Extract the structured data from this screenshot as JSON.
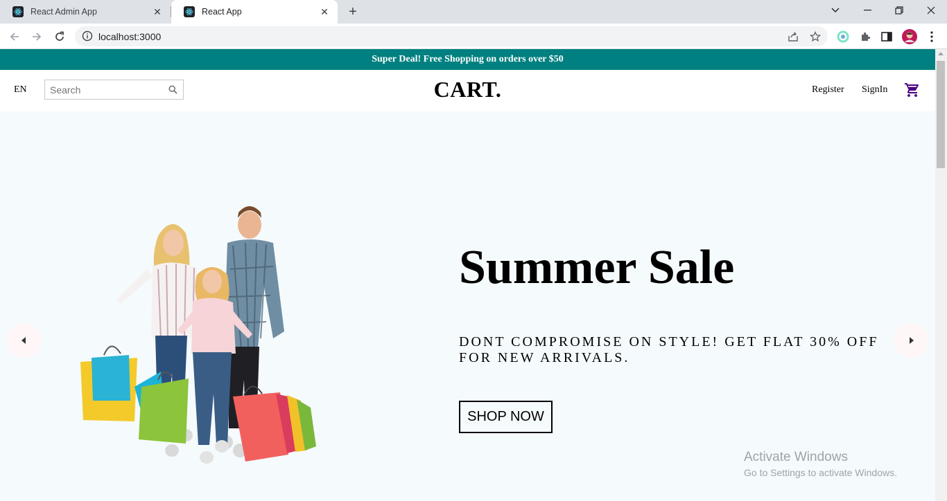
{
  "browser": {
    "tabs": [
      {
        "title": "React Admin App",
        "active": false
      },
      {
        "title": "React App",
        "active": true
      }
    ],
    "url": "localhost:3000"
  },
  "announcement": {
    "text": "Super Deal! Free Shopping on orders over $50",
    "background": "#008080"
  },
  "navbar": {
    "language": "EN",
    "search_placeholder": "Search",
    "logo": "CART.",
    "register_label": "Register",
    "signin_label": "SignIn",
    "cart_icon_color": "#4b0082"
  },
  "hero": {
    "title": "Summer Sale",
    "description": "DONT COMPROMISE ON STYLE! GET FLAT 30% OFF FOR NEW ARRIVALS.",
    "button_label": "SHOP NOW",
    "background": "#f5fafd"
  },
  "watermark": {
    "line1": "Activate Windows",
    "line2": "Go to Settings to activate Windows."
  }
}
